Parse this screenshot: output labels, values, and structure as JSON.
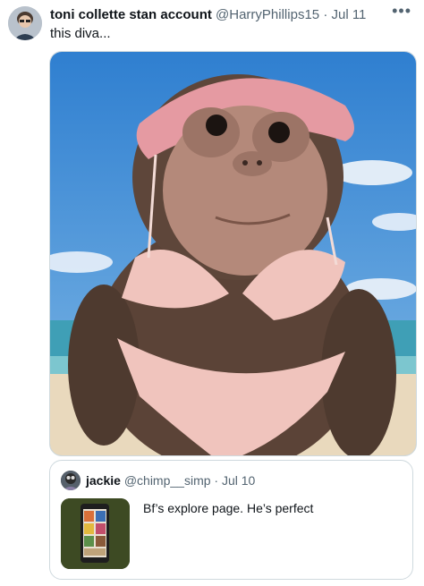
{
  "tweet": {
    "display_name": "toni collette stan account",
    "handle": "@HarryPhillips15",
    "separator": "·",
    "date": "Jul 11",
    "text": "this diva...",
    "more_icon": "more-horizontal-icon"
  },
  "quoted_tweet": {
    "display_name": "jackie",
    "handle": "@chimp__simp",
    "separator": "·",
    "date": "Jul 10",
    "text": "Bf’s explore page. He’s perfect"
  }
}
